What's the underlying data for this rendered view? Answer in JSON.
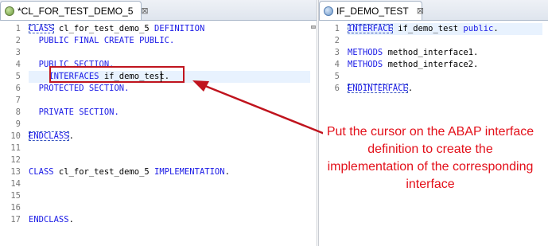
{
  "left_editor": {
    "tab_label": "*CL_FOR_TEST_DEMO_5",
    "tab_close": "⊠",
    "lines": [
      {
        "n": "1",
        "segs": [
          {
            "t": "CLASS",
            "c": "kw boxed"
          },
          {
            "t": " cl_for_test_demo_5 ",
            "c": "plain"
          },
          {
            "t": "DEFINITION",
            "c": "kw"
          }
        ]
      },
      {
        "n": "2",
        "segs": [
          {
            "t": "  PUBLIC FINAL CREATE PUBLIC.",
            "c": "kw"
          }
        ]
      },
      {
        "n": "3",
        "segs": []
      },
      {
        "n": "4",
        "segs": [
          {
            "t": "  PUBLIC SECTION.",
            "c": "kw"
          }
        ]
      },
      {
        "n": "5",
        "segs": [
          {
            "t": "    INTERFACES ",
            "c": "kw"
          },
          {
            "t": "if_demo_test",
            "c": "plain"
          },
          {
            "t": ".",
            "c": "plain"
          }
        ]
      },
      {
        "n": "6",
        "segs": [
          {
            "t": "  PROTECTED SECTION.",
            "c": "kw"
          }
        ]
      },
      {
        "n": "7",
        "segs": []
      },
      {
        "n": "8",
        "segs": [
          {
            "t": "  PRIVATE SECTION.",
            "c": "kw"
          }
        ]
      },
      {
        "n": "9",
        "segs": []
      },
      {
        "n": "10",
        "segs": [
          {
            "t": "ENDCLASS",
            "c": "kw boxed"
          },
          {
            "t": ".",
            "c": "plain"
          }
        ]
      },
      {
        "n": "11",
        "segs": []
      },
      {
        "n": "12",
        "segs": []
      },
      {
        "n": "13",
        "segs": [
          {
            "t": "CLASS",
            "c": "kw"
          },
          {
            "t": " cl_for_test_demo_5 ",
            "c": "plain"
          },
          {
            "t": "IMPLEMENTATION",
            "c": "kw"
          },
          {
            "t": ".",
            "c": "plain"
          }
        ]
      },
      {
        "n": "14",
        "segs": []
      },
      {
        "n": "15",
        "segs": []
      },
      {
        "n": "16",
        "segs": []
      },
      {
        "n": "17",
        "segs": [
          {
            "t": "ENDCLASS",
            "c": "kw"
          },
          {
            "t": ".",
            "c": "plain"
          }
        ]
      }
    ]
  },
  "right_editor": {
    "tab_label": "IF_DEMO_TEST",
    "tab_close": "⊠",
    "lines": [
      {
        "n": "1",
        "segs": [
          {
            "t": "INTERFACE",
            "c": "kw boxed"
          },
          {
            "t": " if_demo_test ",
            "c": "plain"
          },
          {
            "t": "public",
            "c": "kw"
          },
          {
            "t": ".",
            "c": "plain"
          }
        ]
      },
      {
        "n": "2",
        "segs": []
      },
      {
        "n": "3",
        "segs": [
          {
            "t": "METHODS",
            "c": "kw"
          },
          {
            "t": " method_interface1.",
            "c": "plain"
          }
        ]
      },
      {
        "n": "4",
        "segs": [
          {
            "t": "METHODS",
            "c": "kw"
          },
          {
            "t": " method_interface2.",
            "c": "plain"
          }
        ]
      },
      {
        "n": "5",
        "segs": []
      },
      {
        "n": "6",
        "segs": [
          {
            "t": "ENDINTERFACE",
            "c": "kw boxed"
          },
          {
            "t": ".",
            "c": "plain"
          }
        ]
      }
    ]
  },
  "annotation": {
    "text": "Put the cursor on the ABAP interface definition to create the implementation of the corresponding interface"
  },
  "colors": {
    "keyword": "#1a1ae6",
    "annotation": "#e3101a"
  },
  "icons": {
    "class_tab": "abap-class-icon",
    "interface_tab": "abap-interface-icon"
  }
}
